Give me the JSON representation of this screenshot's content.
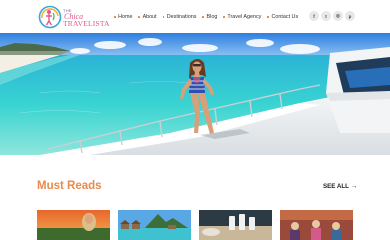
{
  "brand": {
    "logo_the": "THE",
    "logo_chica": "Chica",
    "logo_travelista": "TRAVELISTA"
  },
  "nav": {
    "items": [
      {
        "label": "Home"
      },
      {
        "label": "About"
      },
      {
        "label": "Destinations"
      },
      {
        "label": "Blog"
      },
      {
        "label": "Travel Agency"
      },
      {
        "label": "Contact Us"
      }
    ]
  },
  "socials": [
    {
      "icon": "facebook-icon",
      "glyph": "f"
    },
    {
      "icon": "twitter-icon",
      "glyph": "t"
    },
    {
      "icon": "instagram-icon",
      "glyph": "◎"
    },
    {
      "icon": "pinterest-icon",
      "glyph": "p"
    }
  ],
  "section": {
    "title": "Must Reads",
    "see_all": "SEE ALL",
    "see_all_arrow": "→"
  },
  "colors": {
    "accent": "#e9894a",
    "nav_dot": "#e07b3a",
    "logo_pink": "#e25a8a",
    "sea": "#2fc7d3",
    "sky": "#3f8ee8"
  }
}
